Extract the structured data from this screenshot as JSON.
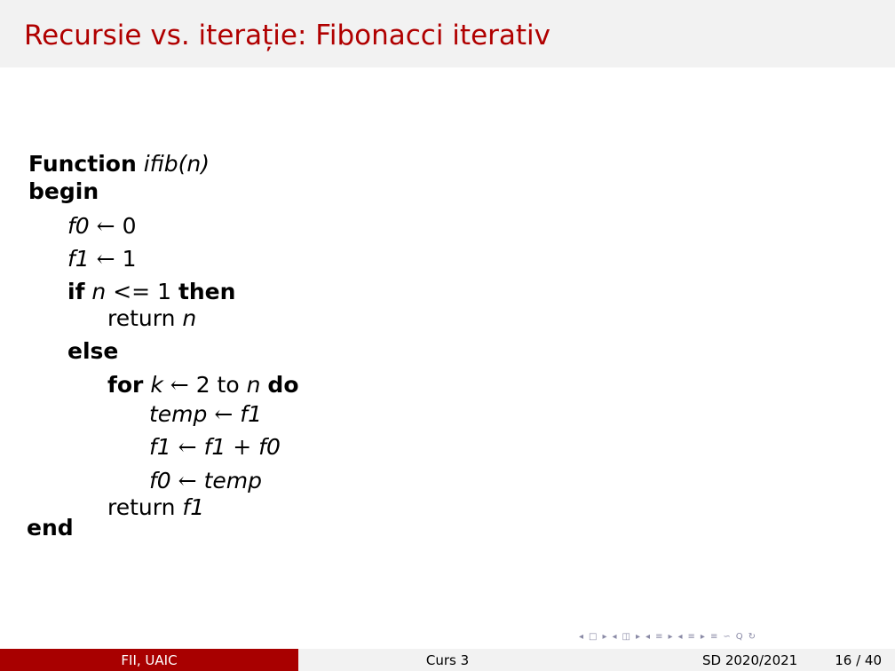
{
  "title": "Recursie vs. iterație: Fibonacci iterativ",
  "algorithm": {
    "function_kw": "Function",
    "function_name": "ifib(n)",
    "begin": "begin",
    "l1_var": "f0",
    "l1_op": "←",
    "l1_val": "0",
    "l2_var": "f1",
    "l2_op": "←",
    "l2_val": "1",
    "if_kw": "if",
    "if_var": "n",
    "if_op": "<=",
    "if_val": "1",
    "then_kw": "then",
    "return1_kw": "return",
    "return1_var": "n",
    "else_kw": "else",
    "for_kw": "for",
    "for_var": "k",
    "for_op": "←",
    "for_from": "2",
    "to_kw": "to",
    "for_to": "n",
    "do_kw": "do",
    "t1_var": "temp",
    "t1_op": "←",
    "t1_val": "f1",
    "t2_var": "f1",
    "t2_op": "←",
    "t2_a": "f1",
    "t2_plus": "+",
    "t2_b": "f0",
    "t3_var": "f0",
    "t3_op": "←",
    "t3_val": "temp",
    "return2_kw": "return",
    "return2_var": "f1",
    "end": "end"
  },
  "nav": {
    "icons": [
      "◂",
      "□",
      "▸",
      "◂",
      "◫",
      "▸",
      "◂",
      "≡",
      "▸",
      "◂",
      "≡",
      "▸",
      "≡",
      "∽",
      "Q",
      "↻"
    ]
  },
  "footer": {
    "left": "FII, UAIC",
    "center": "Curs 3",
    "right": "SD 2020/2021",
    "page": "16 / 40"
  },
  "colors": {
    "title": "#b00000",
    "footer_left_bg": "#a80000",
    "bar_bg": "#f2f2f2"
  }
}
